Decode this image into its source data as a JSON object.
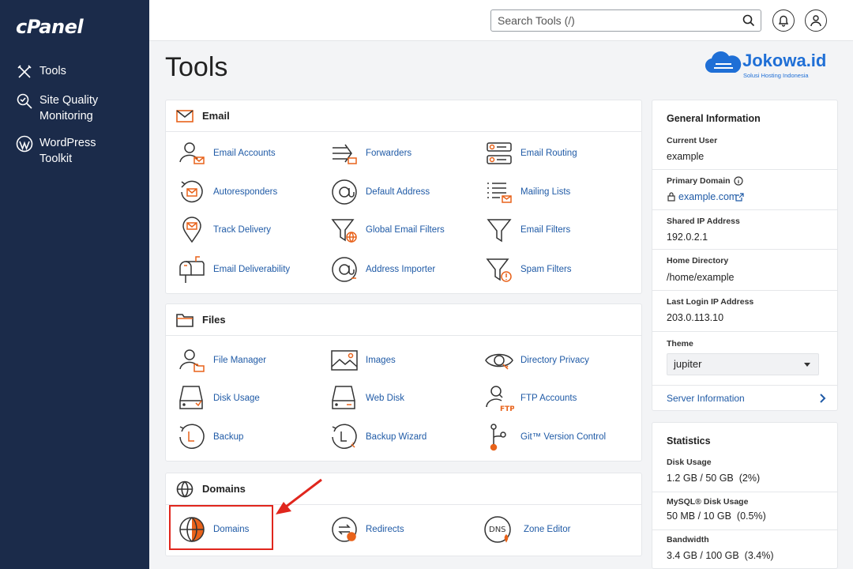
{
  "sidebar": {
    "logo": "cPanel",
    "items": [
      {
        "label": "Tools",
        "icon": "tools-icon"
      },
      {
        "label": "Site Quality Monitoring",
        "icon": "site-quality-icon"
      },
      {
        "label": "WordPress Toolkit",
        "icon": "wordpress-icon"
      }
    ]
  },
  "header": {
    "search_placeholder": "Search Tools (/)"
  },
  "page": {
    "title": "Tools",
    "brand_name": "Jokowa.id",
    "brand_tagline": "Solusi Hosting Indonesia"
  },
  "email": {
    "title": "Email",
    "tools": [
      "Email Accounts",
      "Forwarders",
      "Email Routing",
      "Autoresponders",
      "Default Address",
      "Mailing Lists",
      "Track Delivery",
      "Global Email Filters",
      "Email Filters",
      "Email Deliverability",
      "Address Importer",
      "Spam Filters"
    ]
  },
  "files": {
    "title": "Files",
    "tools": [
      "File Manager",
      "Images",
      "Directory Privacy",
      "Disk Usage",
      "Web Disk",
      "FTP Accounts",
      "Backup",
      "Backup Wizard",
      "Git™ Version Control"
    ]
  },
  "domains": {
    "title": "Domains",
    "tools": [
      "Domains",
      "Redirects",
      "Zone Editor"
    ],
    "dns_label": "DNS"
  },
  "general_info": {
    "title": "General Information",
    "current_user_label": "Current User",
    "current_user": "example",
    "primary_domain_label": "Primary Domain",
    "primary_domain": "example.com",
    "shared_ip_label": "Shared IP Address",
    "shared_ip": "192.0.2.1",
    "home_dir_label": "Home Directory",
    "home_dir": "/home/example",
    "last_login_label": "Last Login IP Address",
    "last_login": "203.0.113.10",
    "theme_label": "Theme",
    "theme": "jupiter",
    "server_info": "Server Information"
  },
  "statistics": {
    "title": "Statistics",
    "disk_label": "Disk Usage",
    "disk": "1.2 GB / 50 GB  (2%)",
    "mysql_label": "MySQL® Disk Usage",
    "mysql": "50 MB / 10 GB  (0.5%)",
    "bandwidth_label": "Bandwidth",
    "bandwidth": "3.4 GB / 100 GB  (3.4%)"
  },
  "colors": {
    "sidebar": "#1b2b4a",
    "link": "#1f5aa6",
    "accent": "#e8621a",
    "brand": "#1f6fd6",
    "highlight": "#e0261d"
  }
}
